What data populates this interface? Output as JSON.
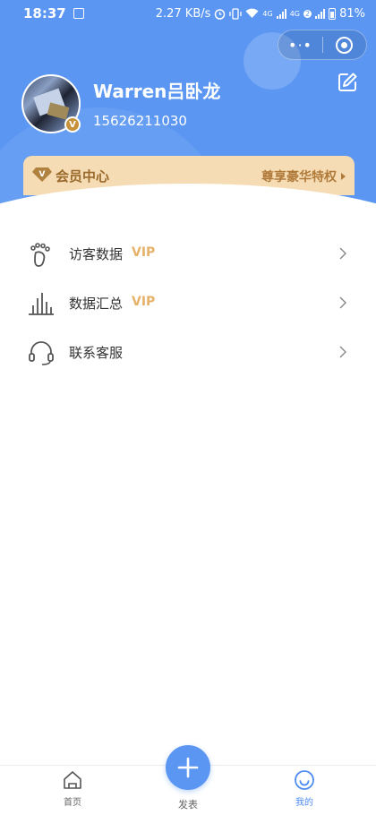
{
  "status_bar": {
    "time": "18:37",
    "network_speed": "2.27 KB/s",
    "network_1": "4G",
    "network_2": "4G",
    "sim_badge": "2",
    "battery": "81%"
  },
  "profile": {
    "username": "Warren吕卧龙",
    "phone": "15626211030",
    "badge": "V"
  },
  "member": {
    "gem_letter": "V",
    "title": "会员中心",
    "privilege": "尊享豪华特权"
  },
  "menu": [
    {
      "label": "访客数据",
      "vip": "VIP",
      "icon": "footprint-icon"
    },
    {
      "label": "数据汇总",
      "vip": "VIP",
      "icon": "bar-chart-icon"
    },
    {
      "label": "联系客服",
      "icon": "headset-icon"
    }
  ],
  "tabs": {
    "home": "首页",
    "publish": "发表",
    "mine": "我的"
  },
  "colors": {
    "primary": "#5a96f2",
    "gold": "#b07a3a",
    "vip": "#e6b26a"
  }
}
